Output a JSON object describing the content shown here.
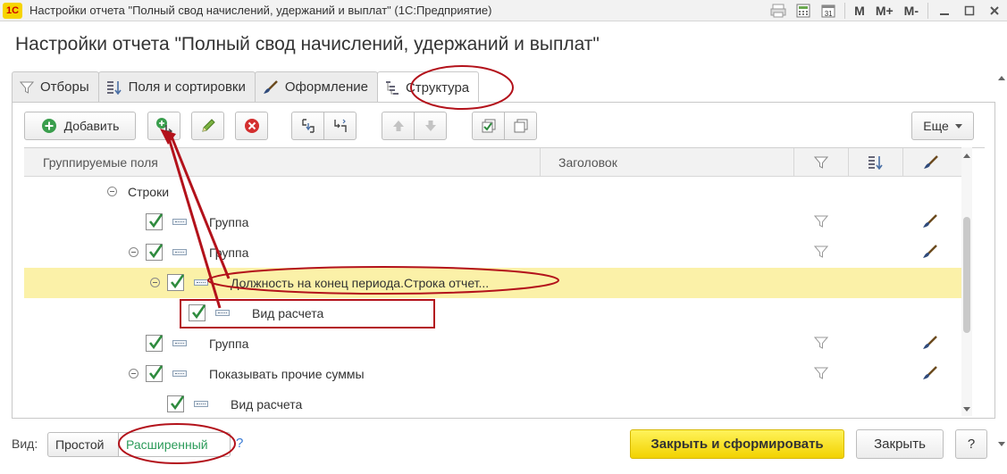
{
  "window": {
    "logo_text": "1С",
    "title": "Настройки отчета \"Полный свод начислений, удержаний и выплат\"  (1С:Предприятие)",
    "calendar_day": "31",
    "m_label": "M",
    "m_plus_label": "M+",
    "m_minus_label": "M-"
  },
  "page_title": "Настройки отчета \"Полный свод начислений, удержаний и выплат\"",
  "tabs": [
    {
      "label": "Отборы",
      "icon": "filter-icon"
    },
    {
      "label": "Поля и сортировки",
      "icon": "sort-icon"
    },
    {
      "label": "Оформление",
      "icon": "brush-icon"
    },
    {
      "label": "Структура",
      "icon": "structure-icon",
      "active": true
    }
  ],
  "toolbar": {
    "add_label": "Добавить",
    "more_label": "Еще"
  },
  "table": {
    "columns": [
      "Группируемые поля",
      "Заголовок"
    ],
    "rows": [
      {
        "label": "Строки",
        "level": 0,
        "collapsible": true,
        "checkbox": false,
        "filter": false,
        "brush": false
      },
      {
        "label": "Группа",
        "level": 1,
        "collapsible": false,
        "checkbox": true,
        "filter": true,
        "brush": true
      },
      {
        "label": "Группа",
        "level": 1,
        "collapsible": true,
        "checkbox": true,
        "filter": true,
        "brush": true
      },
      {
        "label": "Должность на конец периода.Строка отчет...",
        "level": 2,
        "collapsible": true,
        "checkbox": true,
        "filter": false,
        "brush": false,
        "highlighted": true
      },
      {
        "label": "Вид расчета",
        "level": 3,
        "collapsible": false,
        "checkbox": true,
        "filter": false,
        "brush": false
      },
      {
        "label": "Группа",
        "level": 1,
        "collapsible": false,
        "checkbox": true,
        "filter": true,
        "brush": true
      },
      {
        "label": "Показывать прочие суммы",
        "level": 1,
        "collapsible": true,
        "checkbox": true,
        "filter": true,
        "brush": true
      },
      {
        "label": "Вид расчета",
        "level": 2,
        "collapsible": false,
        "checkbox": true,
        "filter": false,
        "brush": false
      }
    ]
  },
  "footer": {
    "view_label": "Вид:",
    "simple_label": "Простой",
    "advanced_label": "Расширенный",
    "help_label": "?",
    "close_and_generate_label": "Закрыть и сформировать",
    "close_label": "Закрыть",
    "question_label": "?"
  },
  "colors": {
    "accent_green": "#2c9b5a",
    "highlight_row": "#fbf1a8",
    "primary_button": "#f2d200",
    "annotation_red": "#b3121b"
  }
}
